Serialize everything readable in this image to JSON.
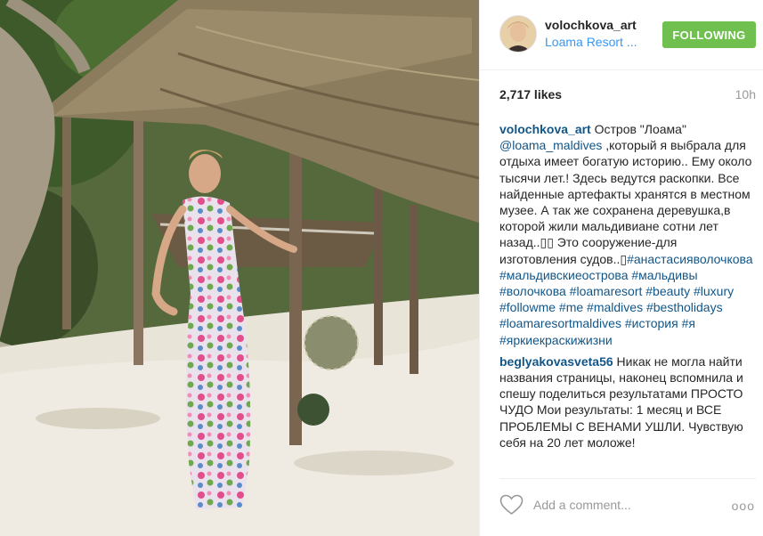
{
  "post": {
    "username": "volochkova_art",
    "location": "Loama Resort ...",
    "follow_label": "FOLLOWING",
    "likes": "2,717 likes",
    "time_ago": "10h"
  },
  "caption": {
    "user": "volochkova_art",
    "text_1": " Остров \"Лоама\" ",
    "mention": "@loama_maldives",
    "text_2": " ,который я выбрала для отдыха имеет богатую историю.. Ему около тысячи лет.! Здесь ведутся раскопки. Все найденные артефакты хранятся в местном музее. А так же сохранена деревушка,в которой жили мальдивиане сотни лет назад..▯▯ Это сооружение-для изготовления судов..▯",
    "hashtags": [
      "#анастасияволочкова",
      "#мальдивскиеострова",
      "#мальдивы",
      "#волочкова",
      "#loamaresort",
      "#beauty",
      "#luxury",
      "#followme",
      "#me",
      "#maldives",
      "#bestholidays",
      "#loamaresortmaldives",
      "#история",
      "#я",
      "#яркиекраскижизни"
    ]
  },
  "comment": {
    "user": "beglyakovasveta56",
    "text": " Никак не могла найти названия страницы, наконец вспомнила и спешу поделиться результатами ПРОСТО ЧУДО Мои результаты: 1 месяц и ВСЕ ПРОБЛЕМЫ С ВЕНАМИ УШЛИ. Чувствую себя на 20 лет моложе!"
  },
  "footer": {
    "add_comment_placeholder": "Add a comment...",
    "more_label": "ooo"
  },
  "icons": {
    "like": "heart-outline-icon",
    "options": "more-options-icon"
  },
  "colors": {
    "follow_green": "#70c050",
    "link_blue": "#125688",
    "location_blue": "#3897f0"
  }
}
